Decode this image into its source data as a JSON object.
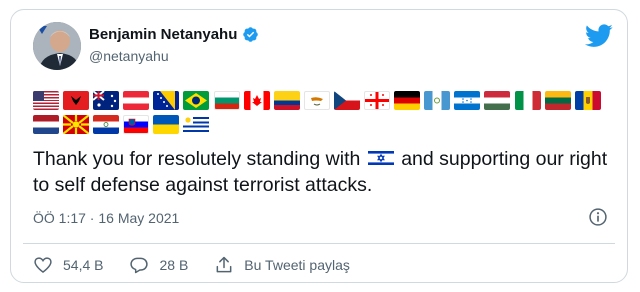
{
  "user": {
    "name": "Benjamin Netanyahu",
    "handle": "@netanyahu"
  },
  "icons": {
    "verified": "verified-badge-icon",
    "brand": "twitter-bird-icon",
    "info": "info-icon",
    "like": "heart-icon",
    "reply": "speech-bubble-icon",
    "share": "share-icon"
  },
  "colors": {
    "accent": "#1d9bf0",
    "text": "#0f1419",
    "muted": "#536471",
    "border": "#cfd9de"
  },
  "tweet": {
    "text_before": "Thank you for resolutely standing with",
    "text_after": "and supporting our right to self defense against terrorist attacks.",
    "timestamp": "ÖÖ 1:17 · 16 May 2021"
  },
  "flags": [
    "united-states",
    "albania",
    "australia",
    "austria",
    "bosnia-and-herzegovina",
    "brazil",
    "bulgaria",
    "canada",
    "colombia",
    "cyprus",
    "czechia",
    "georgia",
    "germany",
    "guatemala",
    "honduras",
    "hungary",
    "italy",
    "lithuania",
    "moldova",
    "netherlands",
    "north-macedonia",
    "paraguay",
    "slovenia",
    "ukraine",
    "uruguay"
  ],
  "actions": {
    "likes": "54,4 B",
    "replies": "28 B",
    "share": "Bu Tweeti paylaş"
  }
}
